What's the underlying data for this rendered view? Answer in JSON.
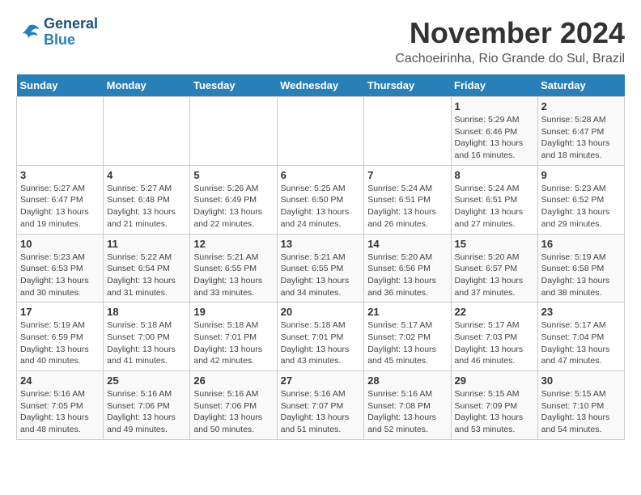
{
  "logo": {
    "line1": "General",
    "line2": "Blue"
  },
  "title": "November 2024",
  "location": "Cachoeirinha, Rio Grande do Sul, Brazil",
  "headers": [
    "Sunday",
    "Monday",
    "Tuesday",
    "Wednesday",
    "Thursday",
    "Friday",
    "Saturday"
  ],
  "weeks": [
    [
      {
        "day": "",
        "info": ""
      },
      {
        "day": "",
        "info": ""
      },
      {
        "day": "",
        "info": ""
      },
      {
        "day": "",
        "info": ""
      },
      {
        "day": "",
        "info": ""
      },
      {
        "day": "1",
        "info": "Sunrise: 5:29 AM\nSunset: 6:46 PM\nDaylight: 13 hours and 16 minutes."
      },
      {
        "day": "2",
        "info": "Sunrise: 5:28 AM\nSunset: 6:47 PM\nDaylight: 13 hours and 18 minutes."
      }
    ],
    [
      {
        "day": "3",
        "info": "Sunrise: 5:27 AM\nSunset: 6:47 PM\nDaylight: 13 hours and 19 minutes."
      },
      {
        "day": "4",
        "info": "Sunrise: 5:27 AM\nSunset: 6:48 PM\nDaylight: 13 hours and 21 minutes."
      },
      {
        "day": "5",
        "info": "Sunrise: 5:26 AM\nSunset: 6:49 PM\nDaylight: 13 hours and 22 minutes."
      },
      {
        "day": "6",
        "info": "Sunrise: 5:25 AM\nSunset: 6:50 PM\nDaylight: 13 hours and 24 minutes."
      },
      {
        "day": "7",
        "info": "Sunrise: 5:24 AM\nSunset: 6:51 PM\nDaylight: 13 hours and 26 minutes."
      },
      {
        "day": "8",
        "info": "Sunrise: 5:24 AM\nSunset: 6:51 PM\nDaylight: 13 hours and 27 minutes."
      },
      {
        "day": "9",
        "info": "Sunrise: 5:23 AM\nSunset: 6:52 PM\nDaylight: 13 hours and 29 minutes."
      }
    ],
    [
      {
        "day": "10",
        "info": "Sunrise: 5:23 AM\nSunset: 6:53 PM\nDaylight: 13 hours and 30 minutes."
      },
      {
        "day": "11",
        "info": "Sunrise: 5:22 AM\nSunset: 6:54 PM\nDaylight: 13 hours and 31 minutes."
      },
      {
        "day": "12",
        "info": "Sunrise: 5:21 AM\nSunset: 6:55 PM\nDaylight: 13 hours and 33 minutes."
      },
      {
        "day": "13",
        "info": "Sunrise: 5:21 AM\nSunset: 6:55 PM\nDaylight: 13 hours and 34 minutes."
      },
      {
        "day": "14",
        "info": "Sunrise: 5:20 AM\nSunset: 6:56 PM\nDaylight: 13 hours and 36 minutes."
      },
      {
        "day": "15",
        "info": "Sunrise: 5:20 AM\nSunset: 6:57 PM\nDaylight: 13 hours and 37 minutes."
      },
      {
        "day": "16",
        "info": "Sunrise: 5:19 AM\nSunset: 6:58 PM\nDaylight: 13 hours and 38 minutes."
      }
    ],
    [
      {
        "day": "17",
        "info": "Sunrise: 5:19 AM\nSunset: 6:59 PM\nDaylight: 13 hours and 40 minutes."
      },
      {
        "day": "18",
        "info": "Sunrise: 5:18 AM\nSunset: 7:00 PM\nDaylight: 13 hours and 41 minutes."
      },
      {
        "day": "19",
        "info": "Sunrise: 5:18 AM\nSunset: 7:01 PM\nDaylight: 13 hours and 42 minutes."
      },
      {
        "day": "20",
        "info": "Sunrise: 5:18 AM\nSunset: 7:01 PM\nDaylight: 13 hours and 43 minutes."
      },
      {
        "day": "21",
        "info": "Sunrise: 5:17 AM\nSunset: 7:02 PM\nDaylight: 13 hours and 45 minutes."
      },
      {
        "day": "22",
        "info": "Sunrise: 5:17 AM\nSunset: 7:03 PM\nDaylight: 13 hours and 46 minutes."
      },
      {
        "day": "23",
        "info": "Sunrise: 5:17 AM\nSunset: 7:04 PM\nDaylight: 13 hours and 47 minutes."
      }
    ],
    [
      {
        "day": "24",
        "info": "Sunrise: 5:16 AM\nSunset: 7:05 PM\nDaylight: 13 hours and 48 minutes."
      },
      {
        "day": "25",
        "info": "Sunrise: 5:16 AM\nSunset: 7:06 PM\nDaylight: 13 hours and 49 minutes."
      },
      {
        "day": "26",
        "info": "Sunrise: 5:16 AM\nSunset: 7:06 PM\nDaylight: 13 hours and 50 minutes."
      },
      {
        "day": "27",
        "info": "Sunrise: 5:16 AM\nSunset: 7:07 PM\nDaylight: 13 hours and 51 minutes."
      },
      {
        "day": "28",
        "info": "Sunrise: 5:16 AM\nSunset: 7:08 PM\nDaylight: 13 hours and 52 minutes."
      },
      {
        "day": "29",
        "info": "Sunrise: 5:15 AM\nSunset: 7:09 PM\nDaylight: 13 hours and 53 minutes."
      },
      {
        "day": "30",
        "info": "Sunrise: 5:15 AM\nSunset: 7:10 PM\nDaylight: 13 hours and 54 minutes."
      }
    ]
  ]
}
